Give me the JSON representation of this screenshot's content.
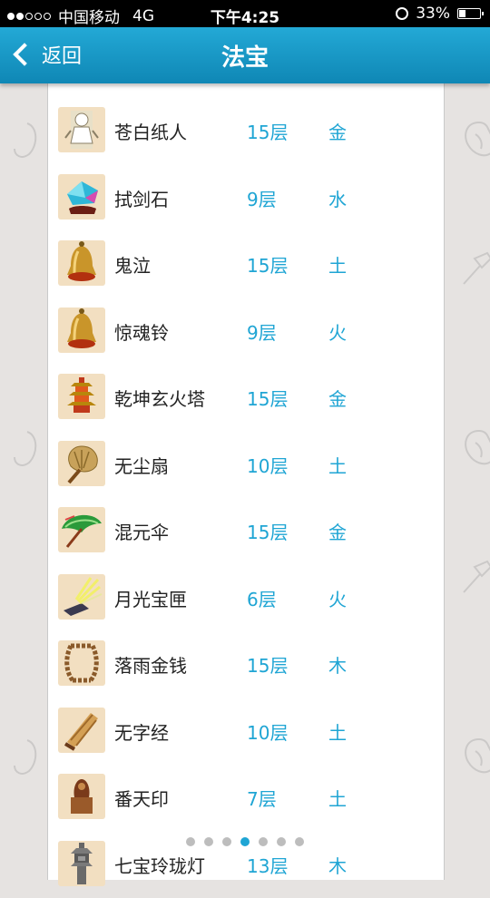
{
  "status_bar": {
    "carrier": "中国移动",
    "network": "4G",
    "time": "下午4:25",
    "battery": "33%",
    "battery_level": 0.33,
    "signal_bars": 2,
    "signal_total": 5
  },
  "navbar": {
    "back_label": "返回",
    "title": "法宝"
  },
  "items": [
    {
      "name": "苍白纸人",
      "level": "15层",
      "element": "金",
      "icon": "paper-doll-icon"
    },
    {
      "name": "拭剑石",
      "level": "9层",
      "element": "水",
      "icon": "gem-stone-icon"
    },
    {
      "name": "鬼泣",
      "level": "15层",
      "element": "土",
      "icon": "bell-icon"
    },
    {
      "name": "惊魂铃",
      "level": "9层",
      "element": "火",
      "icon": "bell-icon"
    },
    {
      "name": "乾坤玄火塔",
      "level": "15层",
      "element": "金",
      "icon": "pagoda-icon"
    },
    {
      "name": "无尘扇",
      "level": "10层",
      "element": "土",
      "icon": "fan-icon"
    },
    {
      "name": "混元伞",
      "level": "15层",
      "element": "金",
      "icon": "umbrella-icon"
    },
    {
      "name": "月光宝匣",
      "level": "6层",
      "element": "火",
      "icon": "light-box-icon"
    },
    {
      "name": "落雨金钱",
      "level": "15层",
      "element": "木",
      "icon": "coin-string-icon"
    },
    {
      "name": "无字经",
      "level": "10层",
      "element": "土",
      "icon": "scroll-icon"
    },
    {
      "name": "番天印",
      "level": "7层",
      "element": "土",
      "icon": "seal-icon"
    },
    {
      "name": "七宝玲珑灯",
      "level": "13层",
      "element": "木",
      "icon": "stone-lantern-icon"
    }
  ],
  "pager": {
    "total": 7,
    "active": 3
  },
  "colors": {
    "accent": "#1fa5d4",
    "nav": "#1896c4",
    "thumb_bg": "#f2dfc1"
  }
}
